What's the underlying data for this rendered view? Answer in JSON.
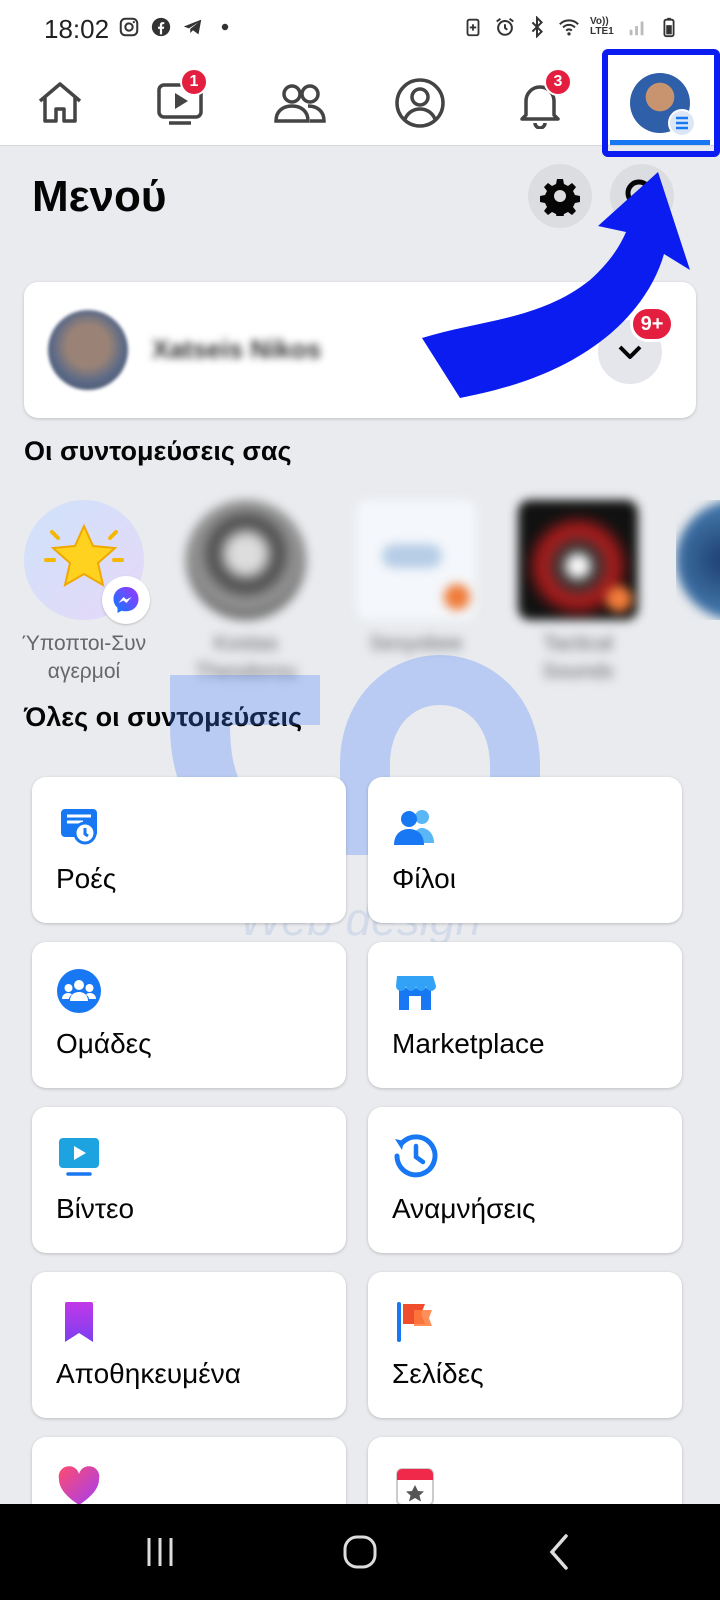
{
  "status_bar": {
    "time": "18:02",
    "left_icons": [
      "instagram-icon",
      "facebook-icon",
      "telegram-icon",
      "dot-icon"
    ],
    "right_icons": [
      "battery-saver-icon",
      "alarm-icon",
      "bluetooth-icon",
      "wifi-icon",
      "volte-icon",
      "signal-icon",
      "battery-icon"
    ],
    "volte_text": "Vo)) LTE1"
  },
  "top_nav": {
    "items": [
      {
        "name": "home",
        "icon": "home-icon"
      },
      {
        "name": "watch",
        "icon": "video-icon",
        "badge": "1"
      },
      {
        "name": "friends",
        "icon": "friends-icon"
      },
      {
        "name": "profile",
        "icon": "profile-icon"
      },
      {
        "name": "notifications",
        "icon": "bell-icon",
        "badge": "3"
      },
      {
        "name": "menu",
        "icon": "avatar-menu-icon",
        "active": true
      }
    ],
    "accent": "#1877f2",
    "badge_color": "#e41e3f"
  },
  "header": {
    "title": "Μενού",
    "settings_icon": "gear-icon",
    "search_icon": "search-icon"
  },
  "profile": {
    "name": "Xatseis Nikos",
    "badge": "9+"
  },
  "shortcuts": {
    "title": "Οι συντομεύσεις σας",
    "items": [
      {
        "label": "Ύποπτοι-Συν αγερμοί"
      },
      {
        "label": "Kostas Theodorou"
      },
      {
        "label": "Sexyobee"
      },
      {
        "label": "Tactical Sounds"
      }
    ]
  },
  "all_shortcuts": {
    "title": "Όλες οι συντομεύσεις",
    "cards": [
      {
        "label": "Ροές",
        "icon": "feeds-icon"
      },
      {
        "label": "Φίλοι",
        "icon": "friends-icon"
      },
      {
        "label": "Ομάδες",
        "icon": "groups-icon"
      },
      {
        "label": "Marketplace",
        "icon": "marketplace-icon"
      },
      {
        "label": "Βίντεο",
        "icon": "video-icon"
      },
      {
        "label": "Αναμνήσεις",
        "icon": "memories-icon"
      },
      {
        "label": "Αποθηκευμένα",
        "icon": "saved-icon"
      },
      {
        "label": "Σελίδες",
        "icon": "pages-icon"
      },
      {
        "label": "",
        "icon": "dating-icon"
      },
      {
        "label": "",
        "icon": "events-icon"
      }
    ]
  },
  "watermark": {
    "text": "Web design"
  }
}
